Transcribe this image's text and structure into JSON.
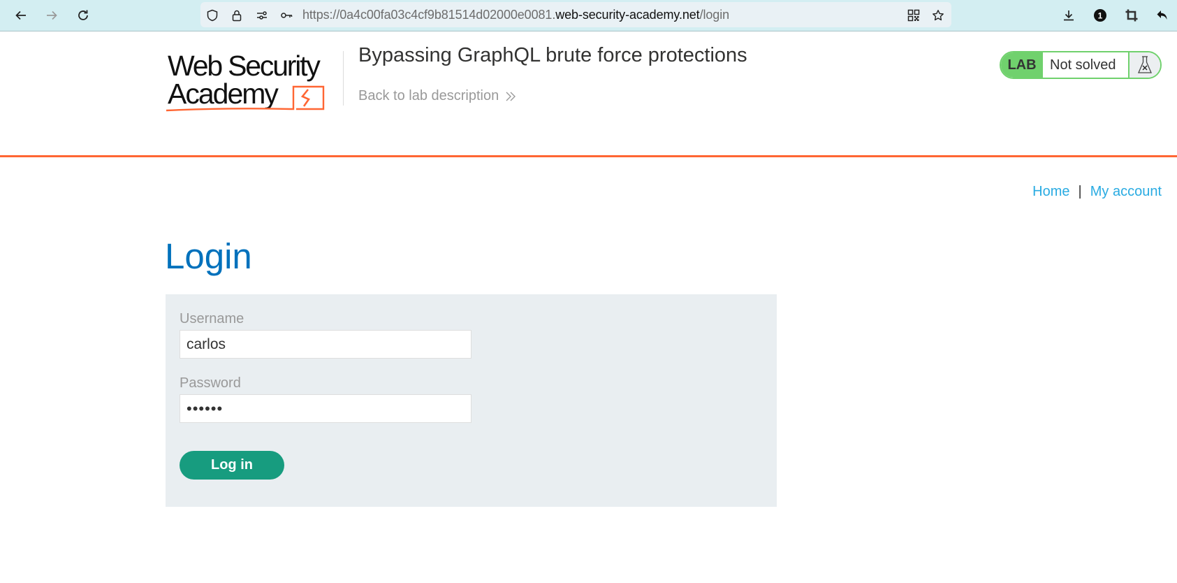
{
  "browser": {
    "url_prefix": "https://0a4c00fa03c4cf9b81514d02000e0081.",
    "url_domain": "web-security-academy.net",
    "url_path": "/login",
    "notification_count": "1",
    "icons": {
      "back": "arrow-left-icon",
      "forward": "arrow-right-icon",
      "reload": "reload-icon",
      "shield": "shield-icon",
      "lock": "lock-icon",
      "permissions": "sliders-icon",
      "key": "key-icon",
      "qr": "qr-code-icon",
      "bookmark": "star-icon",
      "downloads": "download-icon",
      "extension": "badge-icon",
      "screenshot": "crop-icon",
      "undo": "undo-icon"
    }
  },
  "header": {
    "logo_line1": "Web Security",
    "logo_line2": "Academy",
    "lab_title": "Bypassing GraphQL brute force protections",
    "back_link": "Back to lab description",
    "lab_badge": "LAB",
    "lab_status": "Not solved",
    "colors": {
      "accent_orange": "#ff6633",
      "lab_green": "#70d16d"
    }
  },
  "nav": {
    "home": "Home",
    "separator": "|",
    "my_account": "My account"
  },
  "login": {
    "title": "Login",
    "username_label": "Username",
    "username_value": "carlos",
    "password_label": "Password",
    "password_value": "••••••",
    "submit_label": "Log in",
    "colors": {
      "title": "#0071bc",
      "button": "#179c7f",
      "panel": "#e9eef1"
    }
  }
}
